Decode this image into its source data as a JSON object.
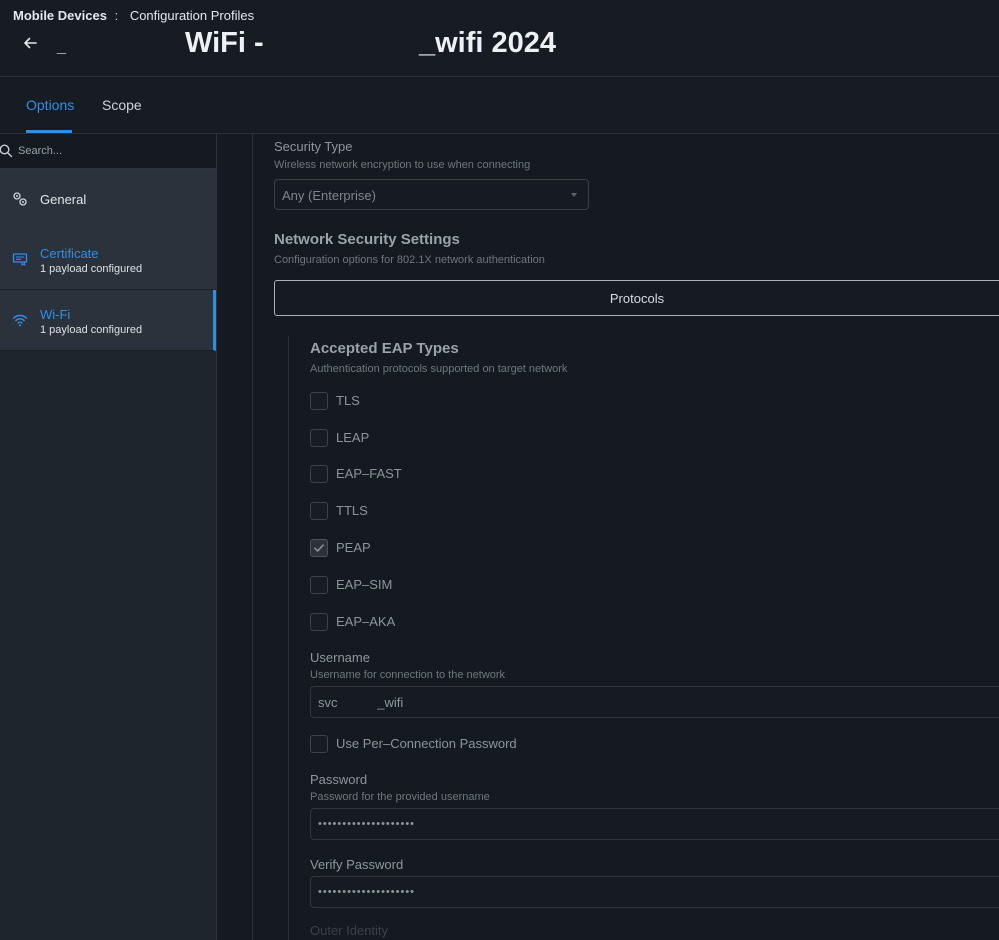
{
  "header": {
    "breadcrumb": {
      "root": "Mobile Devices",
      "separator": ":",
      "current": "Configuration Profiles"
    },
    "owner_prefix": "_",
    "title_part1": "WiFi -",
    "title_part2": "_wifi 2024"
  },
  "tabs": [
    {
      "label": "Options",
      "active": true
    },
    {
      "label": "Scope",
      "active": false
    }
  ],
  "sidebar": {
    "search_placeholder": "Search...",
    "items": [
      {
        "label": "General",
        "sub": "",
        "icon": "gear-pair-icon",
        "selected": false
      },
      {
        "label": "Certificate",
        "sub": "1 payload configured",
        "icon": "certificate-icon",
        "selected": false
      },
      {
        "label": "Wi-Fi",
        "sub": "1 payload configured",
        "icon": "wifi-icon",
        "selected": true
      }
    ]
  },
  "main": {
    "security_type": {
      "label": "Security Type",
      "description": "Wireless network encryption to use when connecting",
      "value": "Any (Enterprise)"
    },
    "network_security": {
      "title": "Network Security Settings",
      "description": "Configuration options for 802.1X network authentication",
      "protocols_tab": "Protocols"
    },
    "eap": {
      "title": "Accepted EAP Types",
      "description": "Authentication protocols supported on target network",
      "types": [
        {
          "label": "TLS",
          "checked": false
        },
        {
          "label": "LEAP",
          "checked": false
        },
        {
          "label": "EAP–FAST",
          "checked": false
        },
        {
          "label": "TTLS",
          "checked": false
        },
        {
          "label": "PEAP",
          "checked": true
        },
        {
          "label": "EAP–SIM",
          "checked": false
        },
        {
          "label": "EAP–AKA",
          "checked": false
        }
      ]
    },
    "username": {
      "label": "Username",
      "description": "Username for connection to the network",
      "value": "svc           _wifi"
    },
    "per_connection_password": {
      "label": "Use Per–Connection Password",
      "checked": false
    },
    "password": {
      "label": "Password",
      "description": "Password for the provided username",
      "value": "••••••••••••••••••••"
    },
    "verify_password": {
      "label": "Verify Password",
      "value": "••••••••••••••••••••"
    },
    "outer_identity_label": "Outer Identity"
  },
  "colors": {
    "accent": "#2f8fe6",
    "header_bg": "#171c23",
    "sidebar_bg": "#1f252d",
    "nav_item_bg": "#2b323b",
    "main_bg": "#151a21"
  }
}
